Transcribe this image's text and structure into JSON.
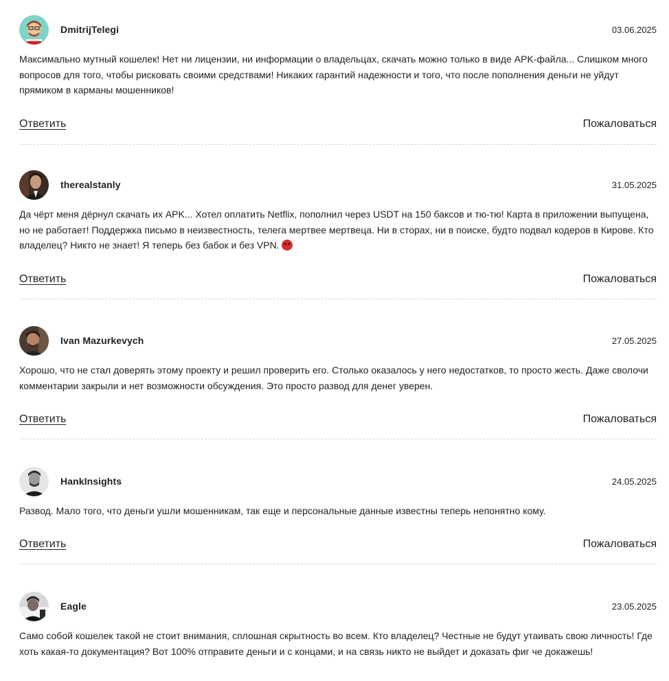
{
  "comments": [
    {
      "author": "DmitrijTelegi",
      "date": "03.06.2025",
      "text": "Максимально мутный кошелек! Нет ни лицензии, ни информации о владельцах, скачать можно только в виде APK-файла... Слишком много вопросов для того, чтобы рисковать своими средствами! Никаких гарантий надежности и того, что после пополнения деньги не уйдут прямиком в карманы мошенников!",
      "reply_label": "Ответить",
      "report_label": "Пожаловаться",
      "avatar_icon": "cartoon-avatar-icon"
    },
    {
      "author": "therealstanly",
      "date": "31.05.2025",
      "text": "Да чёрт меня дёрнул скачать их APK... Хотел оплатить Netflix, пополнил через USDT на 150 баксов и тю-тю! Карта в приложении выпущена, но не работает! Поддержка письмо в неизвестность, телега мертвее мертвеца. Ни в сторах, ни в поиске, будто подвал кодеров в Кирове. Кто владелец? Никто не знает! Я теперь без бабок и без VPN.",
      "emoji": "angry-face-icon",
      "reply_label": "Ответить",
      "report_label": "Пожаловаться",
      "avatar_icon": "user-photo-icon"
    },
    {
      "author": "Ivan Mazurkevych",
      "date": "27.05.2025",
      "text": "Хорошо, что не стал доверять этому проекту и решил проверить его. Столько оказалось у него недостатков, то просто жесть. Даже сволочи комментарии закрыли и нет возможности обсуждения. Это просто развод для денег уверен.",
      "reply_label": "Ответить",
      "report_label": "Пожаловаться",
      "avatar_icon": "user-photo-icon"
    },
    {
      "author": "HankInsights",
      "date": "24.05.2025",
      "text": "Развод. Мало того, что деньги ушли мошенникам, так еще и персональные данные известны теперь непонятно кому.",
      "reply_label": "Ответить",
      "report_label": "Пожаловаться",
      "avatar_icon": "user-photo-icon"
    },
    {
      "author": "Eagle",
      "date": "23.05.2025",
      "text": "Само собой кошелек такой не стоит внимания, сплошная скрытность во всем. Кто владелец? Честные не будут утаивать свою личность! Где хоть какая-то документация? Вот 100% отправите деньги и с концами, и на связь никто не выйдет и доказать фиг че докажешь!",
      "avatar_icon": "user-photo-icon"
    }
  ],
  "colors": {
    "text": "#222222",
    "divider": "#d6d6d6",
    "emoji": "#d32f2f"
  }
}
